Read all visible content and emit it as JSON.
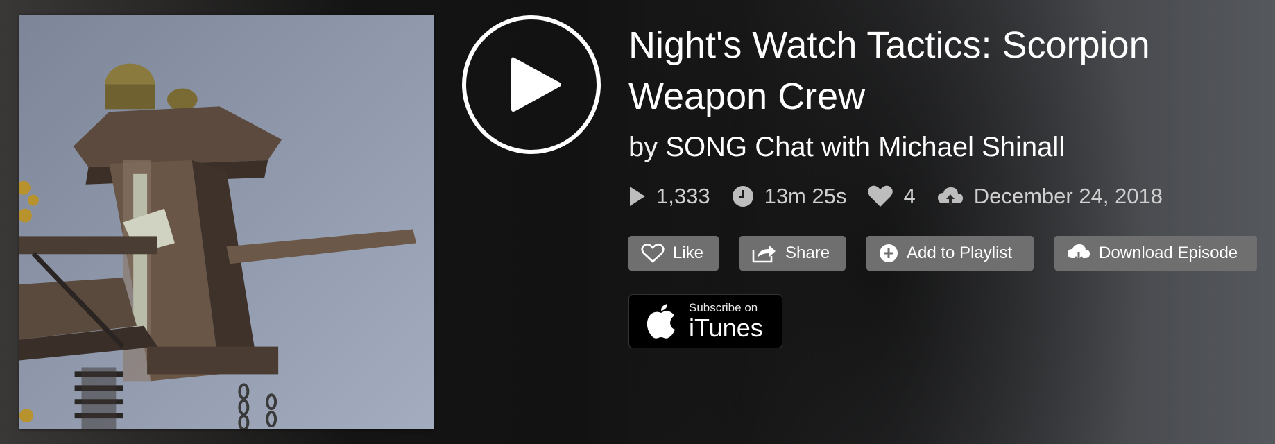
{
  "episode": {
    "title": "Night's Watch Tactics: Scorpion Weapon Crew",
    "by_prefix": "by",
    "author": "SONG Chat with Michael Shinall"
  },
  "stats": {
    "plays": "1,333",
    "duration": "13m 25s",
    "likes": "4",
    "date": "December 24, 2018"
  },
  "actions": {
    "like": "Like",
    "share": "Share",
    "add_to_playlist": "Add to Playlist",
    "download": "Download Episode"
  },
  "itunes": {
    "subscribe": "Subscribe on",
    "name": "iTunes"
  },
  "icons": {
    "play": "play-icon",
    "plays": "play-count-icon",
    "duration": "clock-icon",
    "likes": "heart-icon",
    "date": "cloud-upload-icon",
    "like": "heart-outline-icon",
    "share": "share-arrow-icon",
    "playlist": "plus-circle-icon",
    "download": "cloud-download-icon",
    "itunes": "apple-logo-icon"
  },
  "colors": {
    "button_bg": "#6f6f70",
    "stats_text": "#cfcfcf",
    "text": "#ffffff"
  }
}
